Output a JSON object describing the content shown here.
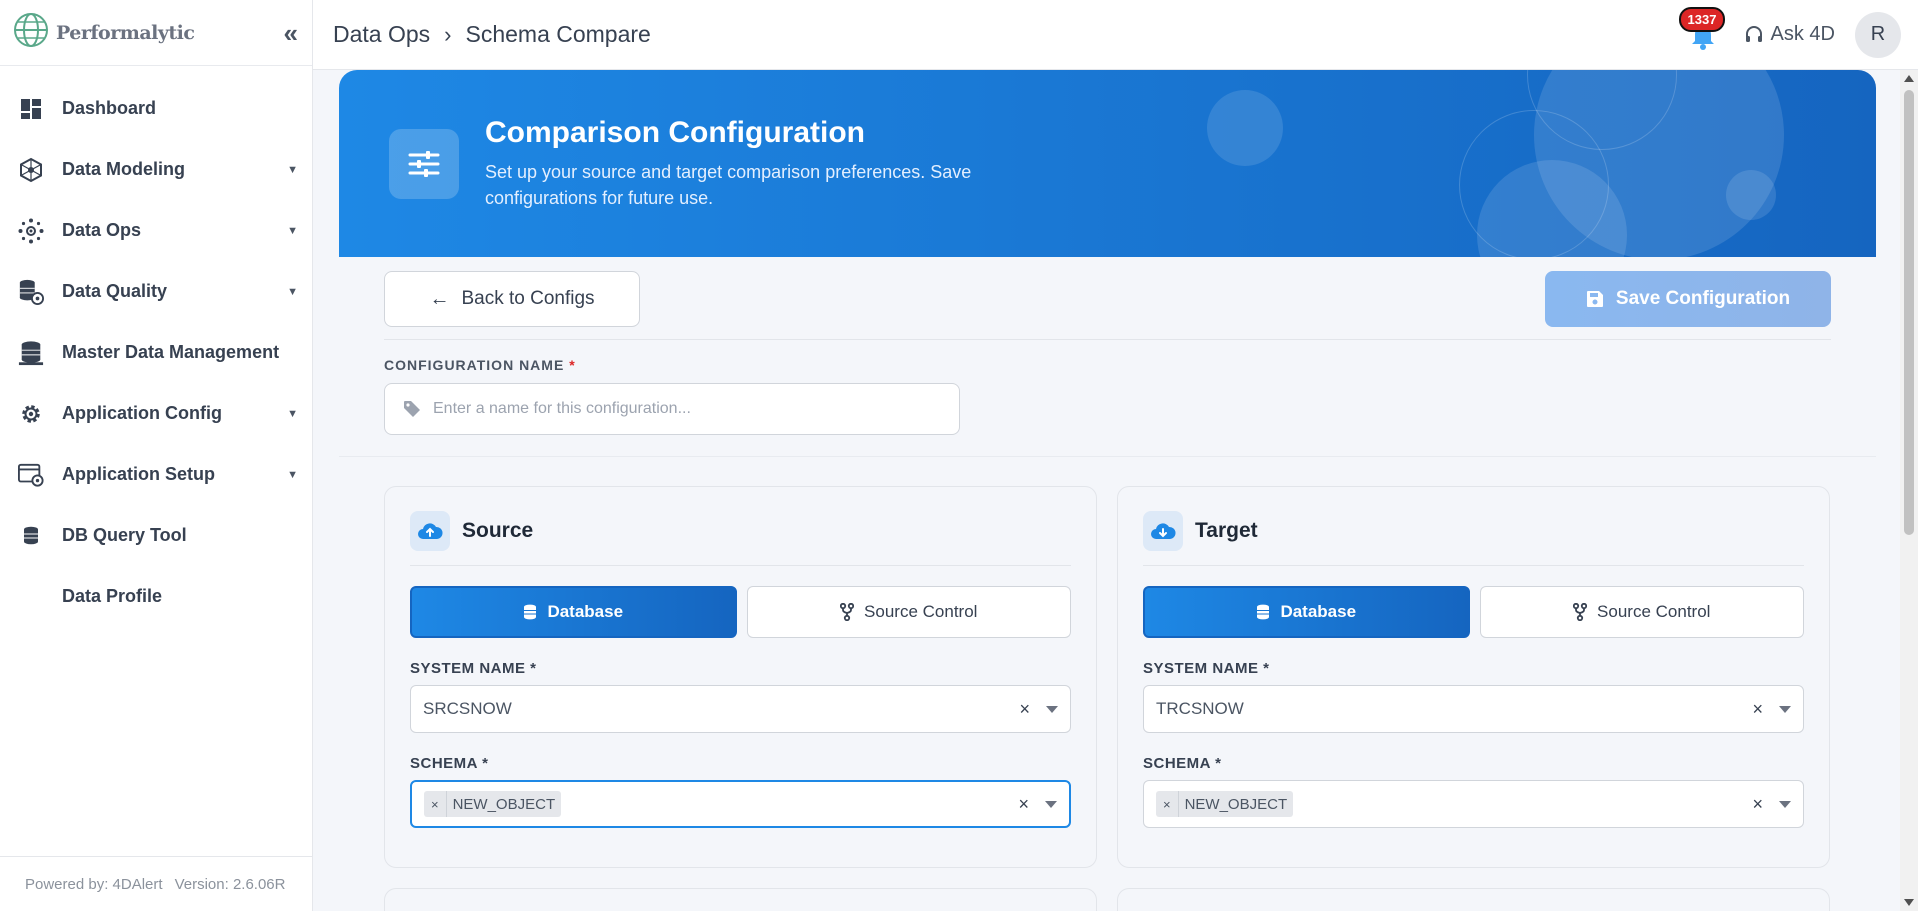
{
  "app": {
    "logo_text": "Performalytic"
  },
  "sidebar": {
    "items": [
      {
        "label": "Dashboard",
        "icon": "dashboard-icon",
        "has_caret": false
      },
      {
        "label": "Data Modeling",
        "icon": "cube-network-icon",
        "has_caret": true
      },
      {
        "label": "Data Ops",
        "icon": "hub-icon",
        "has_caret": true
      },
      {
        "label": "Data Quality",
        "icon": "database-gear-icon",
        "has_caret": true
      },
      {
        "label": "Master Data Management",
        "icon": "database-stack-icon",
        "has_caret": false
      },
      {
        "label": "Application Config",
        "icon": "gear-icon",
        "has_caret": true
      },
      {
        "label": "Application Setup",
        "icon": "window-gear-icon",
        "has_caret": true
      },
      {
        "label": "DB Query Tool",
        "icon": "database-icon",
        "has_caret": false
      },
      {
        "label": "Data Profile",
        "icon": "",
        "has_caret": false
      }
    ],
    "footer_powered": "Powered by: 4DAlert",
    "footer_version": "Version: 2.6.06R"
  },
  "header": {
    "breadcrumb": [
      "Data Ops",
      "Schema Compare"
    ],
    "notification_count": "1337",
    "ask_label": "Ask 4D",
    "avatar_initial": "R"
  },
  "hero": {
    "title": "Comparison Configuration",
    "subtitle": "Set up your source and target comparison preferences. Save configurations for future use."
  },
  "config": {
    "back_label": "Back to Configs",
    "save_label": "Save Configuration",
    "name_label": "CONFIGURATION NAME",
    "name_placeholder": "Enter a name for this configuration...",
    "name_value": ""
  },
  "source": {
    "title": "Source",
    "database_label": "Database",
    "source_control_label": "Source Control",
    "system_label": "SYSTEM NAME",
    "system_value": "SRCSNOW",
    "schema_label": "SCHEMA",
    "schema_chip": "NEW_OBJECT"
  },
  "target": {
    "title": "Target",
    "database_label": "Database",
    "source_control_label": "Source Control",
    "system_label": "SYSTEM NAME",
    "system_value": "TRCSNOW",
    "schema_label": "SCHEMA",
    "schema_chip": "NEW_OBJECT"
  },
  "colors": {
    "accent": "#1e88e5",
    "accent_dark": "#1565c0",
    "save_disabled": "#8ab8f0",
    "badge": "#dc2626"
  }
}
